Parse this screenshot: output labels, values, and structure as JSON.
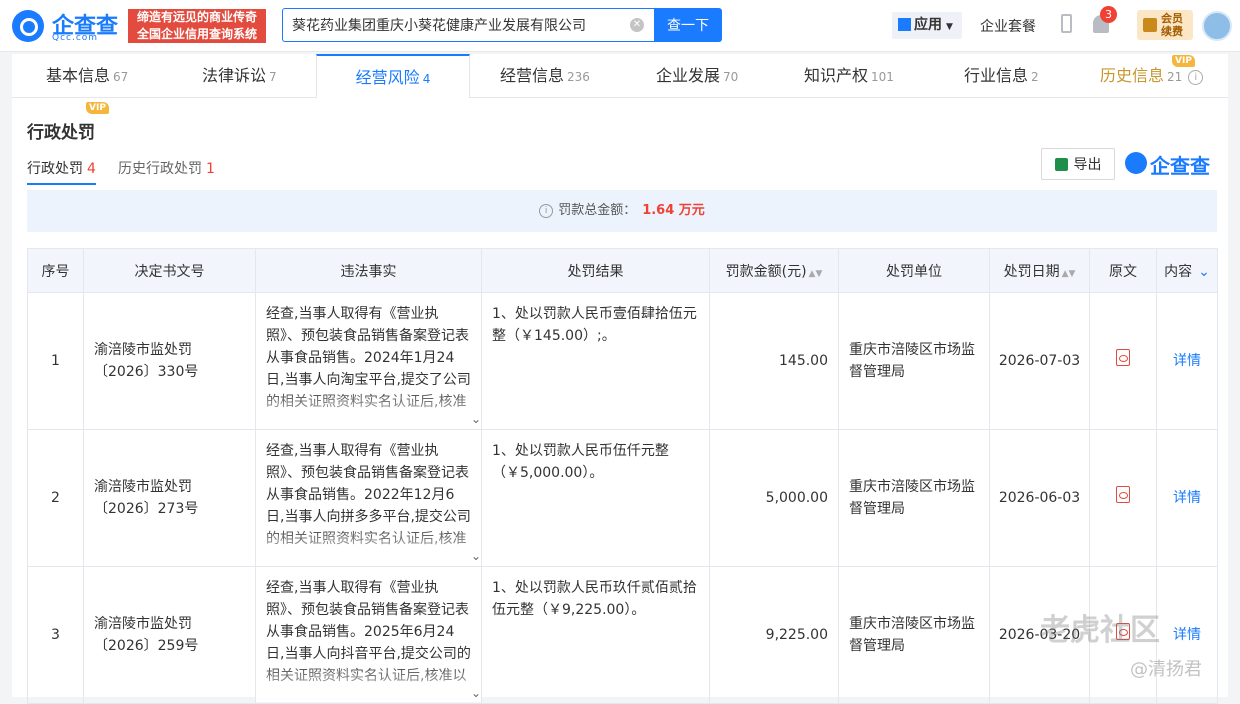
{
  "brand": {
    "name": "企查查",
    "domain": "Qcc.com",
    "slogan_line1": "缔造有远见的商业传奇",
    "slogan_line2": "全国企业信用查询系统"
  },
  "search": {
    "value": "葵花药业集团重庆小葵花健康产业发展有限公司",
    "button_label": "查一下"
  },
  "header": {
    "apps_label": "应用",
    "plans_label": "企业套餐",
    "notification_count": "3",
    "member_label": "会员续费"
  },
  "tabs": [
    {
      "label": "基本信息",
      "count": "67"
    },
    {
      "label": "法律诉讼",
      "count": "7"
    },
    {
      "label": "经营风险",
      "count": "4"
    },
    {
      "label": "经营信息",
      "count": "236"
    },
    {
      "label": "企业发展",
      "count": "70"
    },
    {
      "label": "知识产权",
      "count": "101"
    },
    {
      "label": "行业信息",
      "count": "2"
    },
    {
      "label": "历史信息",
      "count": "21"
    }
  ],
  "vip_label": "VIP",
  "section": {
    "title": "行政处罚",
    "subtabs": [
      {
        "label": "行政处罚",
        "count": "4"
      },
      {
        "label": "历史行政处罚",
        "count": "1"
      }
    ],
    "export_label": "导出",
    "watermark_brand": "企查查",
    "summary_label": "罚款总金额：",
    "summary_amount": "1.64 万元"
  },
  "table": {
    "headers": [
      "序号",
      "决定书文号",
      "违法事实",
      "处罚结果",
      "罚款金额(元)",
      "处罚单位",
      "处罚日期",
      "原文",
      "内容"
    ],
    "rows": [
      {
        "no": "1",
        "doc_no": "渝涪陵市监处罚〔2026〕330号",
        "fact": "经查,当事人取得有《营业执照》、预包装食品销售备案登记表从事食品销售。2024年1月24日,当事人向淘宝平台,提交了公司的相关证照资料实名认证后,核准",
        "result": "1、处以罚款人民币壹佰肆拾伍元整（￥145.00）;。",
        "amount": "145.00",
        "authority": "重庆市涪陵区市场监督管理局",
        "date": "2026-07-03",
        "detail": "详情"
      },
      {
        "no": "2",
        "doc_no": "渝涪陵市监处罚〔2026〕273号",
        "fact": "经查,当事人取得有《营业执照》、预包装食品销售备案登记表从事食品销售。2022年12月6日,当事人向拼多多平台,提交公司的相关证照资料实名认证后,核准",
        "result": "1、处以罚款人民币伍仟元整（￥5,000.00）。",
        "amount": "5,000.00",
        "authority": "重庆市涪陵区市场监督管理局",
        "date": "2026-06-03",
        "detail": "详情"
      },
      {
        "no": "3",
        "doc_no": "渝涪陵市监处罚〔2026〕259号",
        "fact": "经查,当事人取得有《营业执照》、预包装食品销售备案登记表从事食品销售。2025年6月24日,当事人向抖音平台,提交公司的相关证照资料实名认证后,核准以",
        "result": "1、处以罚款人民币玖仟贰佰贰拾伍元整（￥9,225.00）。",
        "amount": "9,225.00",
        "authority": "重庆市涪陵区市场监督管理局",
        "date": "2026-03-20",
        "detail": "详情"
      }
    ]
  },
  "watermarks": {
    "forum": "老虎社区",
    "author": "@清扬君"
  }
}
